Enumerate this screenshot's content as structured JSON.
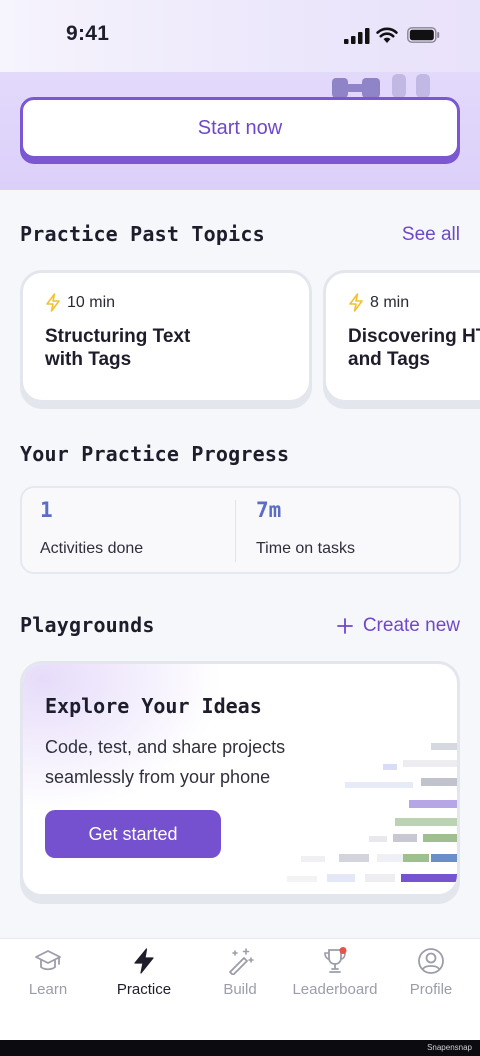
{
  "status_bar": {
    "time": "9:41"
  },
  "hero": {
    "start_label": "Start now"
  },
  "past_topics": {
    "title": "Practice Past Topics",
    "see_all": "See all",
    "cards": [
      {
        "duration": "10 min",
        "title": "Structuring Text\nwith Tags"
      },
      {
        "duration": "8 min",
        "title": "Discovering HTML\nand Tags"
      }
    ]
  },
  "progress": {
    "title": "Your Practice Progress",
    "stats": [
      {
        "value": "1",
        "label": "Activities done"
      },
      {
        "value": "7m",
        "label": "Time on tasks"
      }
    ]
  },
  "playgrounds": {
    "title": "Playgrounds",
    "create_new": "Create new",
    "card": {
      "title": "Explore Your Ideas",
      "description": "Code, test, and share projects seamlessly from your phone",
      "button": "Get started"
    }
  },
  "tabbar": {
    "tabs": [
      {
        "label": "Learn",
        "icon": "graduation-cap-icon",
        "active": false
      },
      {
        "label": "Practice",
        "icon": "lightning-icon",
        "active": true
      },
      {
        "label": "Build",
        "icon": "magic-wand-icon",
        "active": false
      },
      {
        "label": "Leaderboard",
        "icon": "trophy-icon",
        "active": false
      },
      {
        "label": "Profile",
        "icon": "user-circle-icon",
        "active": false
      }
    ]
  },
  "watermark": "Snapensnap",
  "colors": {
    "accent": "#7550cf",
    "stat_value": "#5a6ec4",
    "bolt": "#f2c12e",
    "notification_dot": "#e5534b"
  }
}
